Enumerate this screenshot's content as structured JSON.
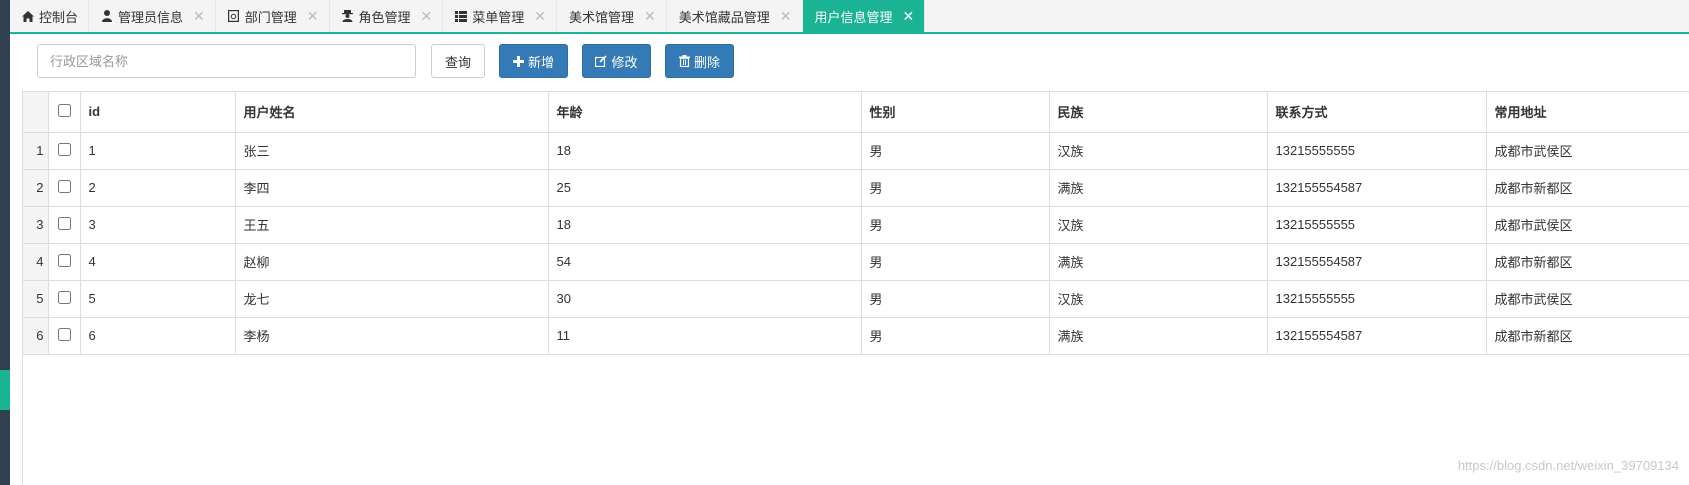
{
  "tabs": [
    {
      "label": "控制台",
      "icon": "home-icon",
      "active": false,
      "closable": false
    },
    {
      "label": "管理员信息",
      "icon": "user-icon",
      "active": false,
      "closable": true
    },
    {
      "label": "部门管理",
      "icon": "file-icon",
      "active": false,
      "closable": true
    },
    {
      "label": "角色管理",
      "icon": "user-secret-icon",
      "active": false,
      "closable": true
    },
    {
      "label": "菜单管理",
      "icon": "list-icon",
      "active": false,
      "closable": true
    },
    {
      "label": "美术馆管理",
      "icon": "",
      "active": false,
      "closable": true
    },
    {
      "label": "美术馆藏品管理",
      "icon": "",
      "active": false,
      "closable": true
    },
    {
      "label": "用户信息管理",
      "icon": "",
      "active": true,
      "closable": true
    }
  ],
  "toolbar": {
    "search_placeholder": "行政区域名称",
    "search_value": "",
    "query_label": "查询",
    "add_label": "新增",
    "edit_label": "修改",
    "delete_label": "删除"
  },
  "table": {
    "columns": [
      "id",
      "用户姓名",
      "年龄",
      "性别",
      "民族",
      "联系方式",
      "常用地址"
    ],
    "rows": [
      {
        "num": "1",
        "id": "1",
        "name": "张三",
        "age": "18",
        "gender": "男",
        "ethnicity": "汉族",
        "phone": "13215555555",
        "address": "成都市武侯区"
      },
      {
        "num": "2",
        "id": "2",
        "name": "李四",
        "age": "25",
        "gender": "男",
        "ethnicity": "满族",
        "phone": "132155554587",
        "address": "成都市新都区"
      },
      {
        "num": "3",
        "id": "3",
        "name": "王五",
        "age": "18",
        "gender": "男",
        "ethnicity": "汉族",
        "phone": "13215555555",
        "address": "成都市武侯区"
      },
      {
        "num": "4",
        "id": "4",
        "name": "赵柳",
        "age": "54",
        "gender": "男",
        "ethnicity": "满族",
        "phone": "132155554587",
        "address": "成都市新都区"
      },
      {
        "num": "5",
        "id": "5",
        "name": "龙七",
        "age": "30",
        "gender": "男",
        "ethnicity": "汉族",
        "phone": "13215555555",
        "address": "成都市武侯区"
      },
      {
        "num": "6",
        "id": "6",
        "name": "李杨",
        "age": "11",
        "gender": "男",
        "ethnicity": "满族",
        "phone": "132155554587",
        "address": "成都市新都区"
      }
    ]
  },
  "watermark": "https://blog.csdn.net/weixin_39709134",
  "colors": {
    "accent": "#1ab394",
    "primary": "#337ab7",
    "sidebar": "#2f4050"
  }
}
